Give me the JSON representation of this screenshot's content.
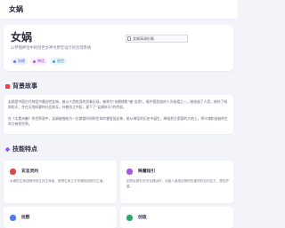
{
  "header": {
    "app_title": "女娲"
  },
  "hero": {
    "title": "女娲",
    "subtitle": "以伴随神话中的创世女神为原型设计的治理系统",
    "image_alt": "女娲高清形象",
    "tags": [
      {
        "label": "治理",
        "color": "#5b7cf7",
        "bg": "#eef1ff",
        "text_color": "#4a5fd1"
      },
      {
        "label": "神话",
        "color": "#b45ad8",
        "bg": "#f6ecfc",
        "text_color": "#9a45c0"
      },
      {
        "label": "创世",
        "color": "#3ba6e0",
        "bg": "#e9f5fc",
        "text_color": "#2d8cc2"
      }
    ]
  },
  "sections": {
    "background_title": "背景故事",
    "features_title": "技能特点"
  },
  "story": {
    "paragraphs": [
      "女娲是中国古代神话中最创世女神，被以人首蛇身的形象出现，被称为\"玄鹤缘影\"被\"女阴\"。据中国民族的人文始祖之一，她创造了人类，修补了倾斜的天，并在天地间建构社会和兵。补着拉之中起，星下了\"女娲补天\"的传说。",
      "在《太素诗集》的世界观中，女娲被描绘为一位掌管时间和生命的睿智慧女神，她从神话的历史中诞生，降临到主索索的大地上，将众魂和创造的生命力带到世界。"
    ]
  },
  "features": [
    {
      "title": "玄言灵约",
      "description": "女娲的生命回响所到生存生命者，使得生命之中灵魂找到依归之道。",
      "icon": "crystal-icon",
      "color": "#e04848"
    },
    {
      "title": "降魔指引",
      "description": "如同女娲在补天治理运作，对敌人造成巨神的伤害同时治疗友方，提供护盾。",
      "icon": "guide-icon",
      "color": "#a55ad8"
    },
    {
      "title": "抚慰",
      "description": "",
      "icon": "soothe-icon",
      "color": "#4f7cf2"
    },
    {
      "title": "创造",
      "description": "",
      "icon": "create-icon",
      "color": "#2fa86a"
    }
  ],
  "colors": {
    "accent_red": "#e04848",
    "accent_purple": "#8a5cf0",
    "background": "#f3f4fa"
  }
}
